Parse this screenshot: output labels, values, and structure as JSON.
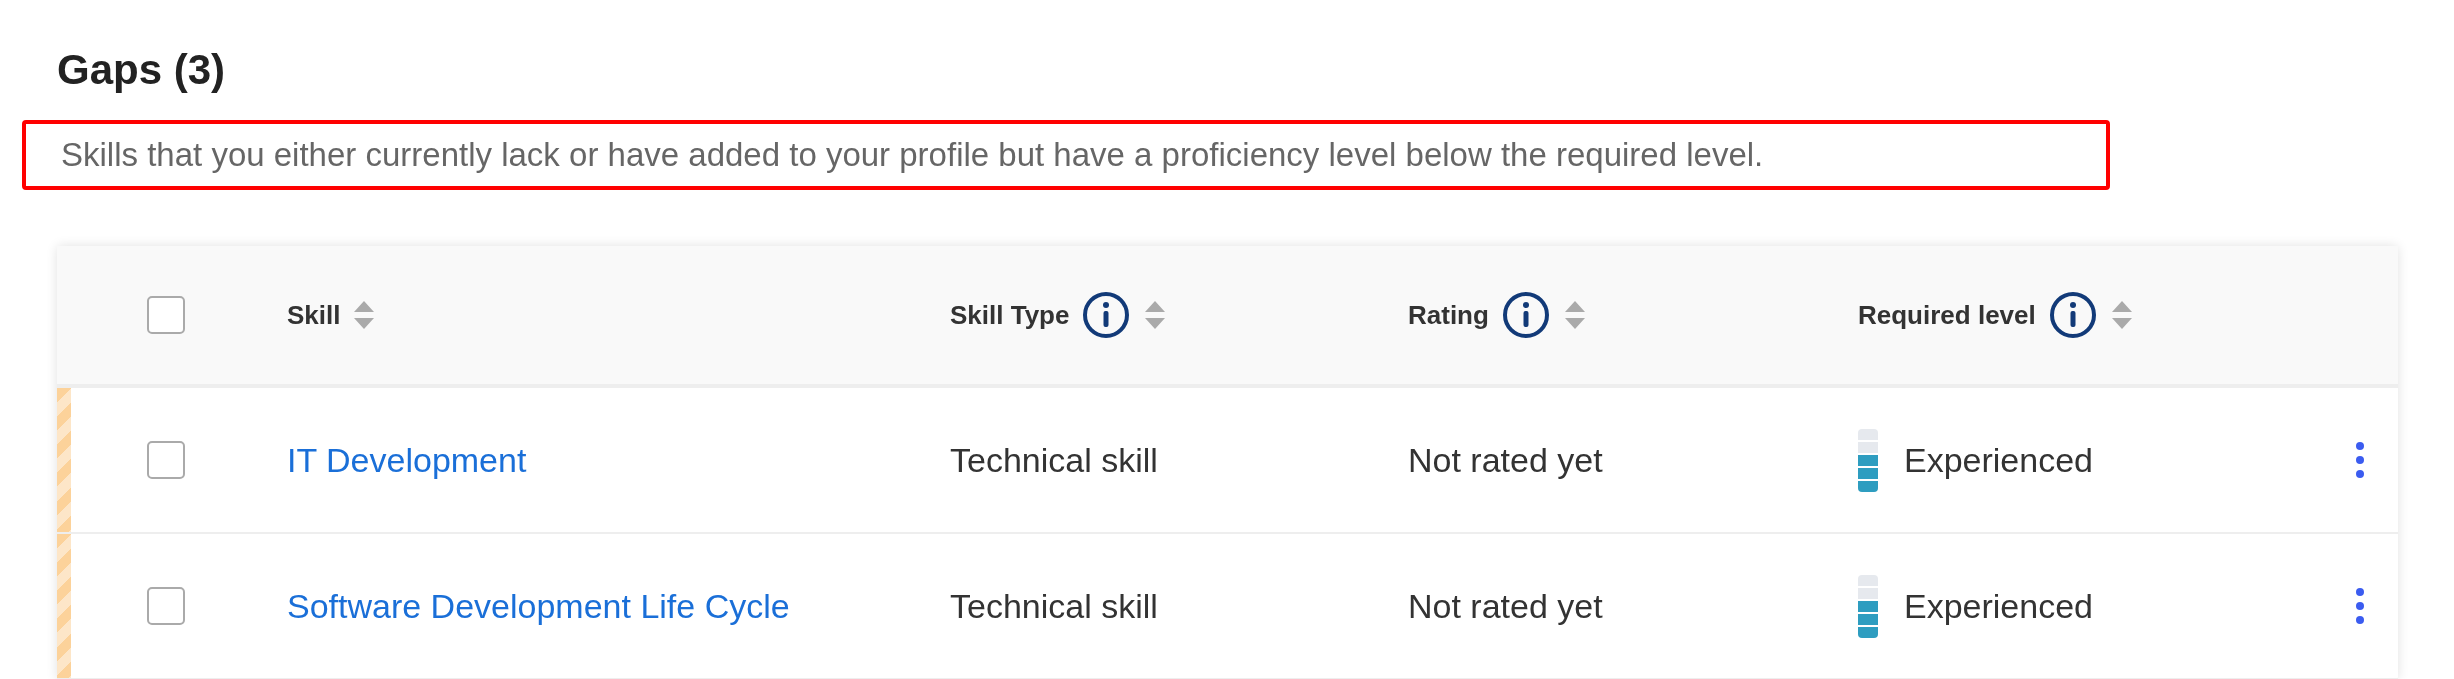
{
  "section": {
    "title": "Gaps (3)",
    "description": "Skills that you either currently lack or have added to your profile but have a proficiency level below the required level.",
    "highlighted": true
  },
  "table": {
    "select_all": {
      "checked": false
    },
    "columns": [
      {
        "label": "Skill",
        "info": false,
        "sortable": true
      },
      {
        "label": "Skill Type",
        "info": true,
        "sortable": true
      },
      {
        "label": "Rating",
        "info": true,
        "sortable": true
      },
      {
        "label": "Required level",
        "info": true,
        "sortable": true
      }
    ],
    "rows": [
      {
        "checked": false,
        "skill": "IT Development",
        "skill_type": "Technical skill",
        "rating": "Not rated yet",
        "required_level": "Experienced",
        "level": 0.6
      },
      {
        "checked": false,
        "skill": "Software Development Life Cycle",
        "skill_type": "Technical skill",
        "rating": "Not rated yet",
        "required_level": "Experienced",
        "level": 0.6
      }
    ]
  }
}
